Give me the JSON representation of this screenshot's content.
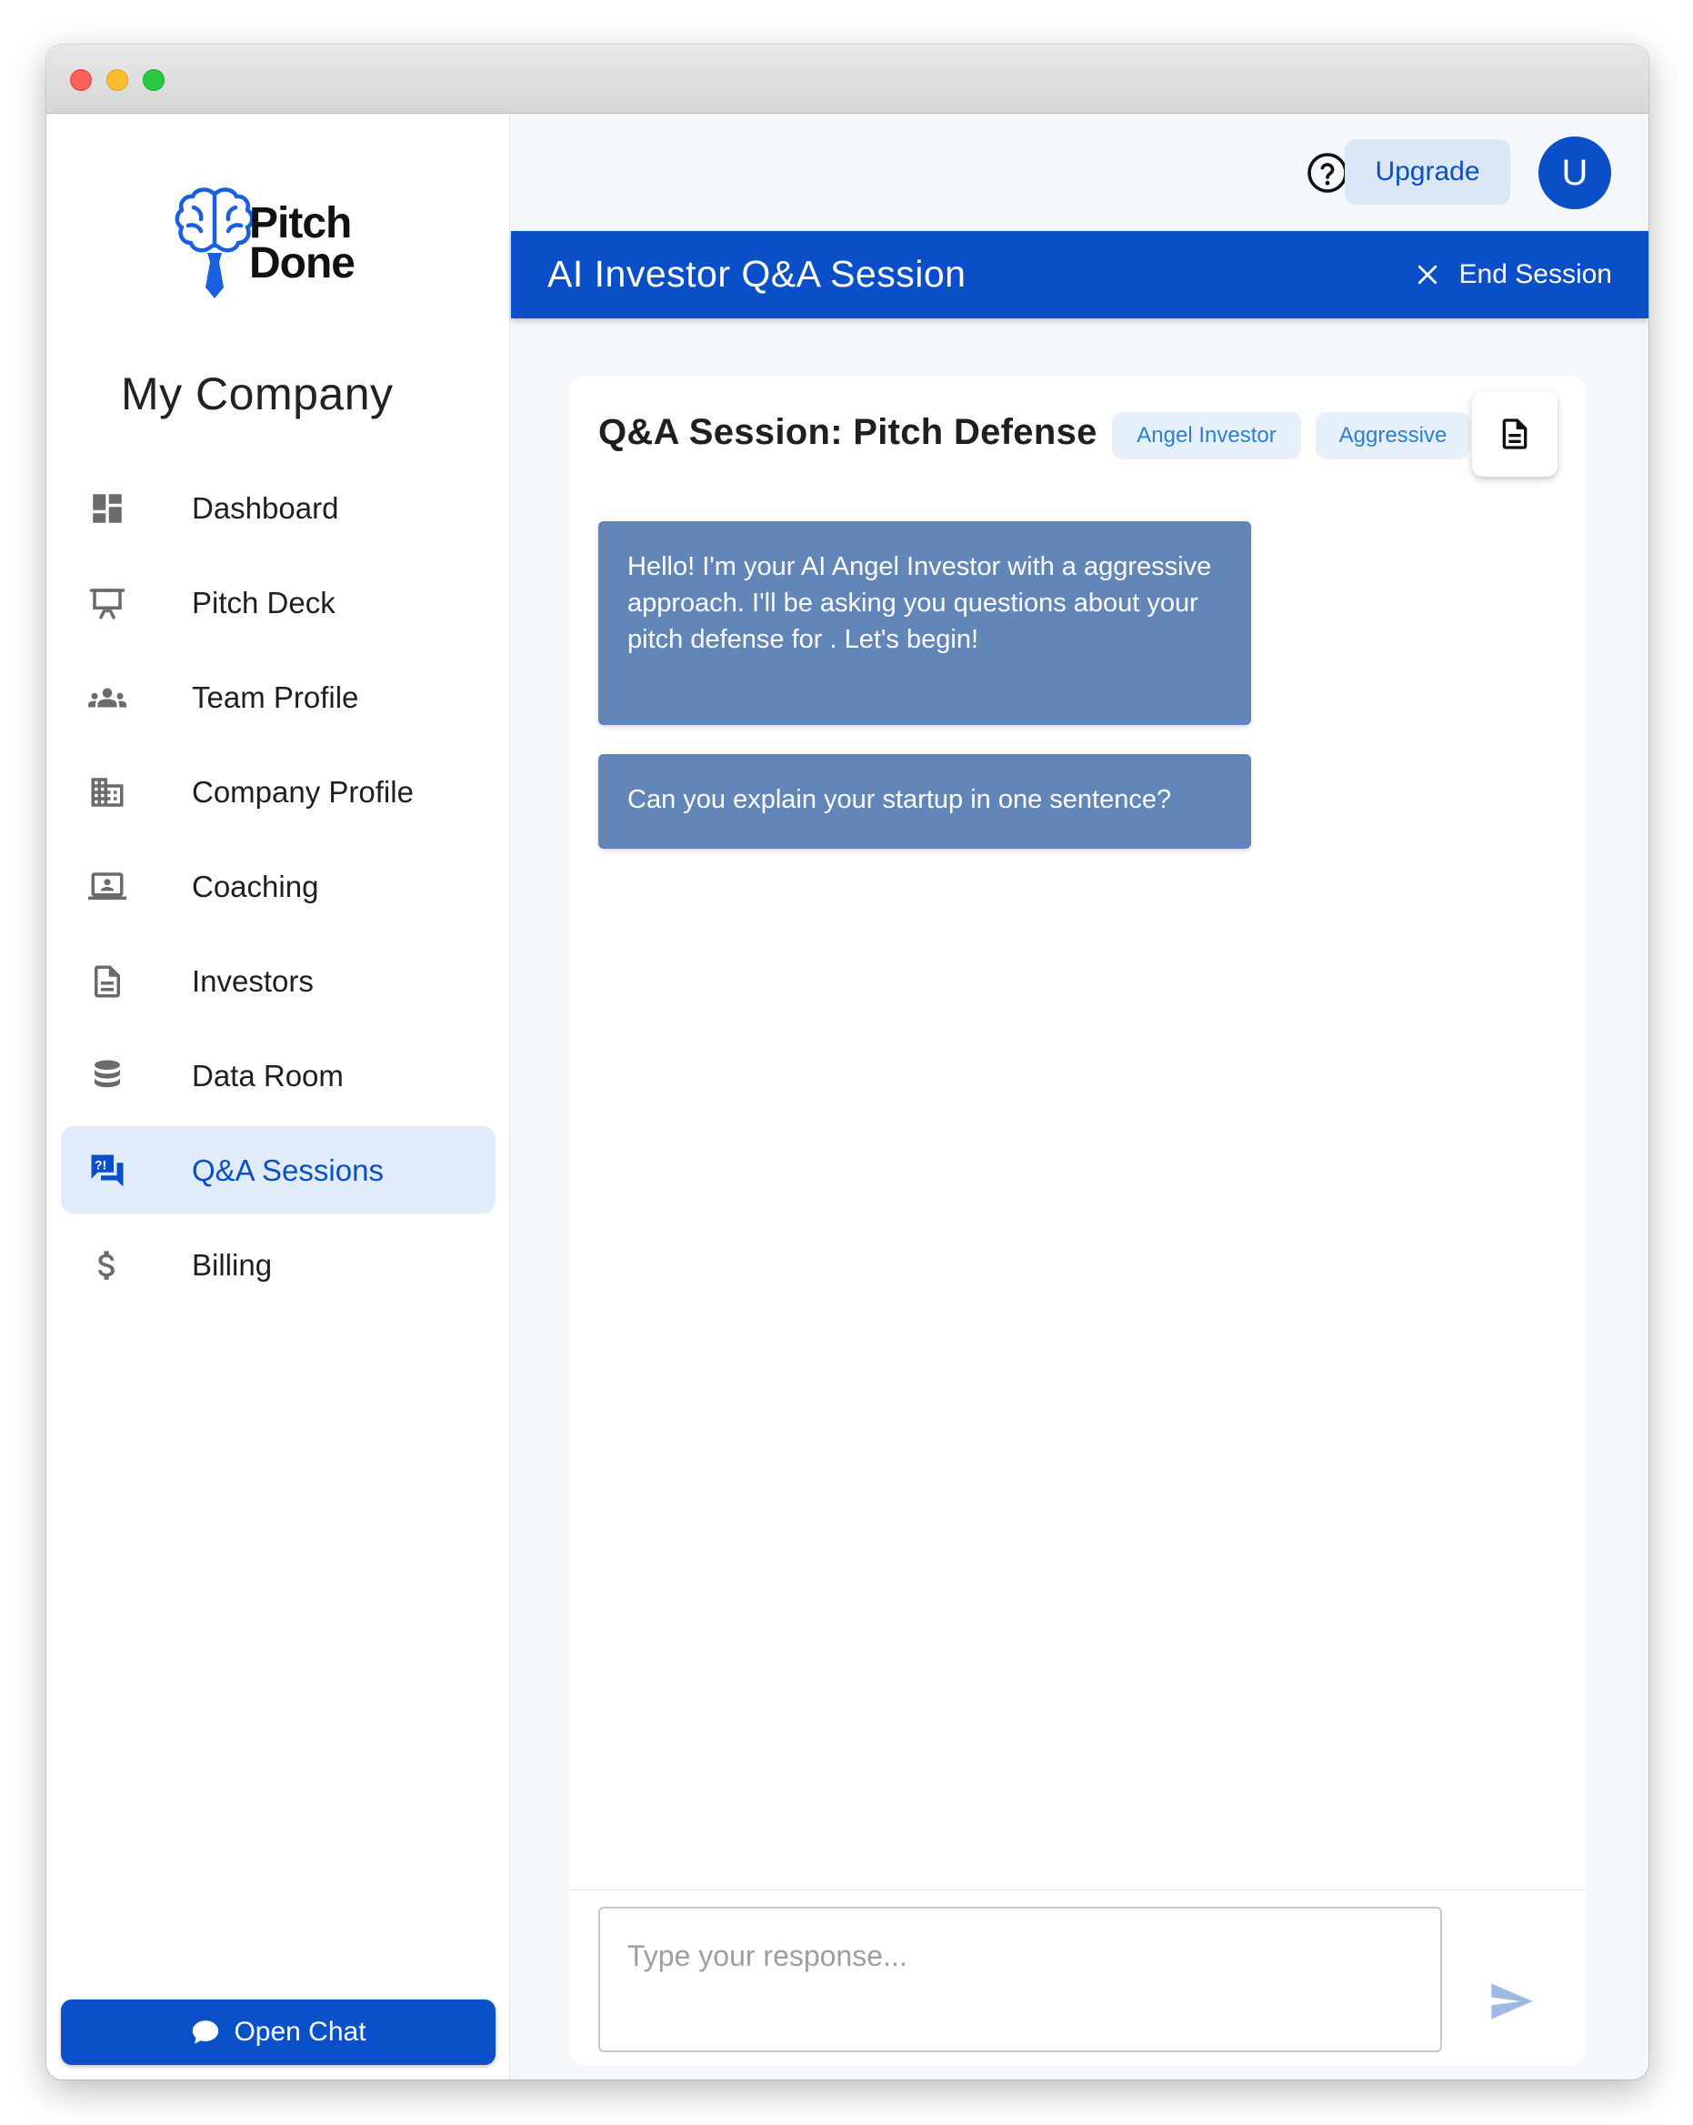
{
  "brand": {
    "name_line1": "Pitch",
    "name_line2": "Done"
  },
  "sidebar": {
    "company_name": "My Company",
    "items": [
      {
        "label": "Dashboard",
        "icon": "dashboard-icon"
      },
      {
        "label": "Pitch Deck",
        "icon": "presentation-icon"
      },
      {
        "label": "Team Profile",
        "icon": "group-icon"
      },
      {
        "label": "Company Profile",
        "icon": "building-icon"
      },
      {
        "label": "Coaching",
        "icon": "laptop-user-icon"
      },
      {
        "label": "Investors",
        "icon": "document-icon"
      },
      {
        "label": "Data Room",
        "icon": "database-icon"
      },
      {
        "label": "Q&A Sessions",
        "icon": "qa-icon",
        "active": true
      },
      {
        "label": "Billing",
        "icon": "dollar-icon"
      }
    ],
    "open_chat_label": "Open Chat"
  },
  "header": {
    "upgrade_label": "Upgrade",
    "avatar_initial": "U"
  },
  "session_bar": {
    "title": "AI Investor Q&A Session",
    "end_label": "End Session"
  },
  "session": {
    "title": "Q&A Session: Pitch Defense",
    "tags": [
      "Angel Investor",
      "Aggressive"
    ],
    "messages": [
      "Hello! I'm your AI Angel Investor with a aggressive approach. I'll be asking you questions about your pitch defense for . Let's begin!",
      "Can you explain your startup in one sentence?"
    ]
  },
  "composer": {
    "placeholder": "Type your response..."
  },
  "colors": {
    "primary": "#0a4fc7",
    "message_bg": "#6386b9",
    "active_nav_bg": "#e1ebf9"
  }
}
